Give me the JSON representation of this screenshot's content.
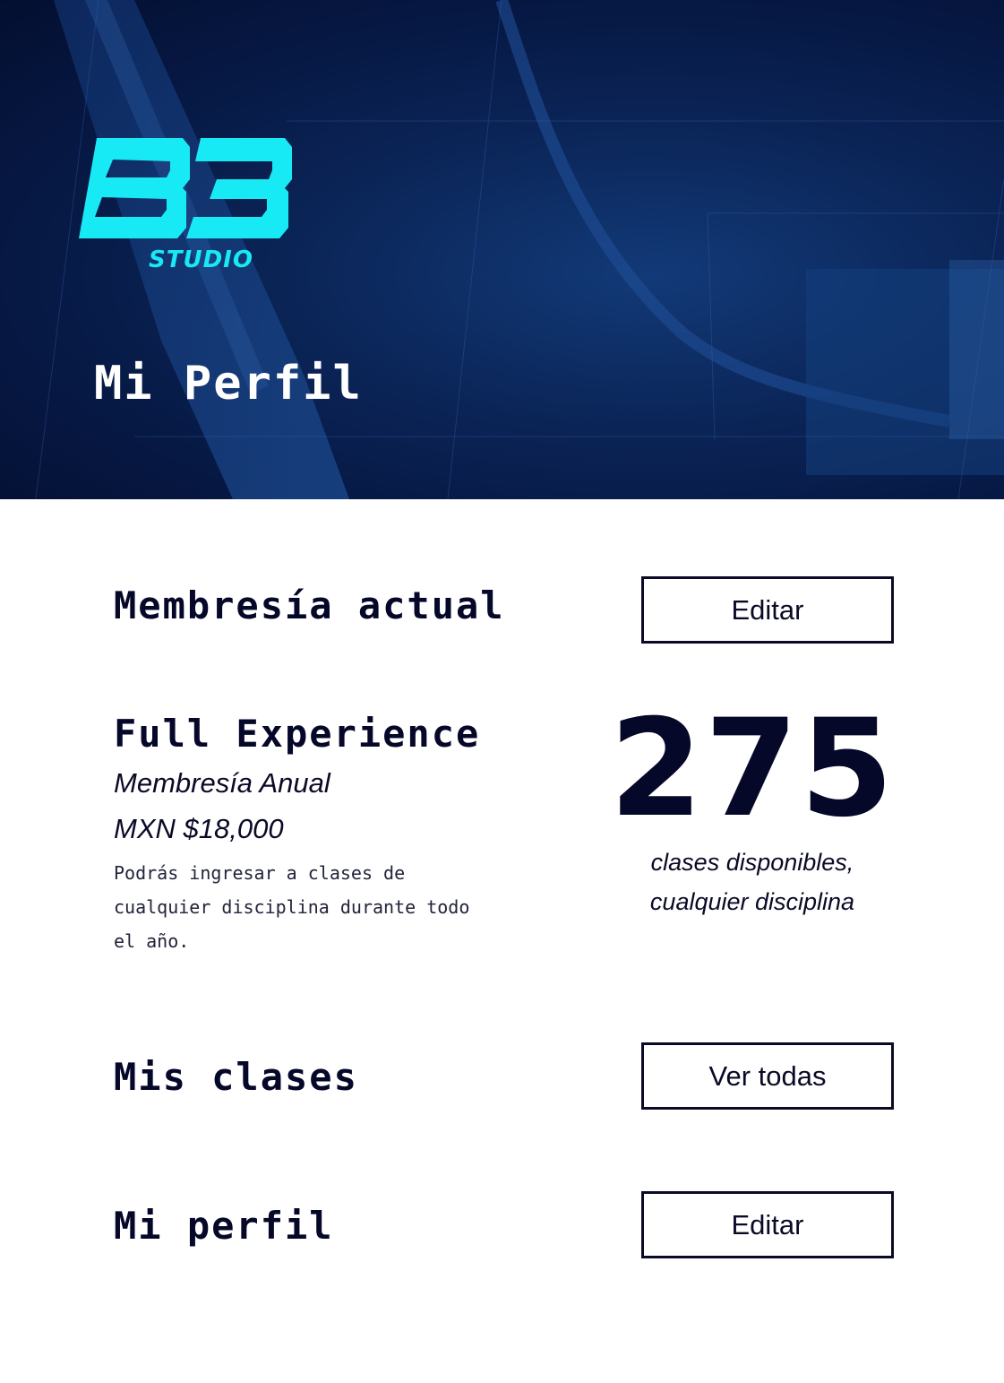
{
  "brand": {
    "logo_text": "B3",
    "logo_subtext": "STUDIO",
    "accent_color": "#18eaf5"
  },
  "header": {
    "title": "Mi Perfil"
  },
  "membership": {
    "section_title": "Membresía actual",
    "edit_label": "Editar",
    "plan_name": "Full Experience",
    "plan_type": "Membresía Anual",
    "plan_price": "MXN $18,000",
    "description": "Podrás ingresar a clases de cualquier disciplina durante todo el año.",
    "available_classes": "275",
    "available_caption_line1": "clases disponibles,",
    "available_caption_line2": "cualquier disciplina"
  },
  "classes": {
    "section_title": "Mis clases",
    "view_all_label": "Ver todas"
  },
  "profile": {
    "section_title": "Mi perfil",
    "edit_label": "Editar"
  },
  "colors": {
    "hero_background": "#061843",
    "text_dark": "#06082a"
  }
}
